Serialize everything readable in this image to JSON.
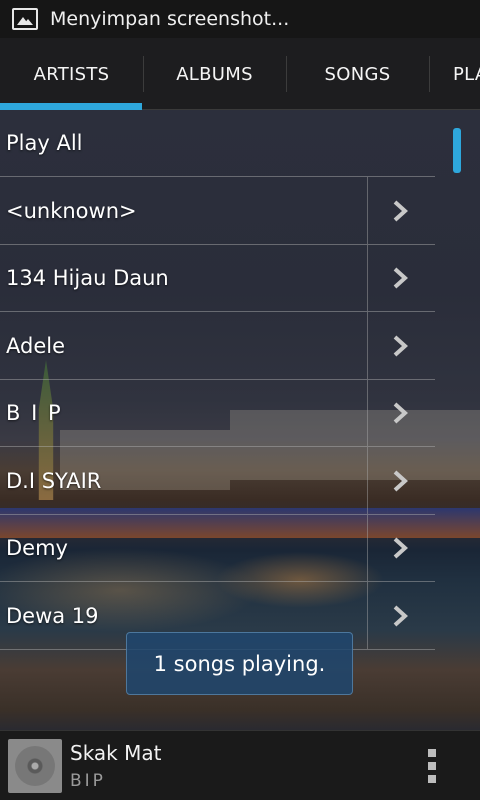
{
  "status_bar": {
    "text": "Menyimpan screenshot..."
  },
  "tabs": [
    {
      "label": "ARTISTS",
      "active": true
    },
    {
      "label": "ALBUMS",
      "active": false
    },
    {
      "label": "SONGS",
      "active": false
    },
    {
      "label": "PLA",
      "active": false
    }
  ],
  "list": {
    "play_all_label": "Play All",
    "items": [
      {
        "label": "<unknown>"
      },
      {
        "label": "134 Hijau Daun"
      },
      {
        "label": "Adele"
      },
      {
        "label": "B I P"
      },
      {
        "label": "D.I SYAIR"
      },
      {
        "label": "Demy"
      },
      {
        "label": "Dewa 19"
      }
    ]
  },
  "toast": {
    "text": "1 songs playing."
  },
  "now_playing": {
    "title": "Skak Mat",
    "artist": "BIP"
  },
  "colors": {
    "accent": "#2ea7dc",
    "toast_bg": "#1e466e"
  }
}
